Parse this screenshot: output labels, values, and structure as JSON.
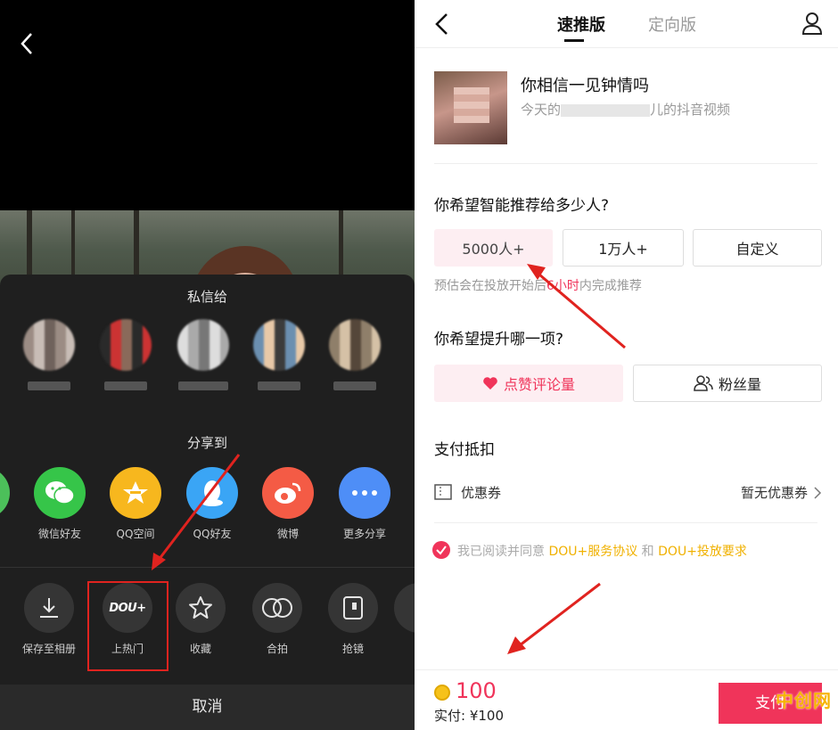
{
  "left": {
    "dm_title": "私信给",
    "share_title": "分享到",
    "share_items": [
      {
        "label": "微信好友",
        "icon": "wechat-icon",
        "color": "#36c549"
      },
      {
        "label": "QQ空间",
        "icon": "qzone-star-icon",
        "color": "#f7b71e"
      },
      {
        "label": "QQ好友",
        "icon": "qq-penguin-icon",
        "color": "#3aa5f5"
      },
      {
        "label": "微博",
        "icon": "weibo-icon",
        "color": "#f45b45"
      },
      {
        "label": "更多分享",
        "icon": "more-dots-icon",
        "color": "#4e8ef7"
      }
    ],
    "actions": [
      {
        "label": "保存至相册",
        "icon": "download-icon"
      },
      {
        "label": "上热门",
        "icon": "dou-plus-icon",
        "logo_text": "DOU+"
      },
      {
        "label": "收藏",
        "icon": "star-icon"
      },
      {
        "label": "合拍",
        "icon": "duet-icon"
      },
      {
        "label": "抢镜",
        "icon": "react-icon"
      }
    ],
    "cancel": "取消"
  },
  "right": {
    "tabs": {
      "active": "速推版",
      "inactive": "定向版"
    },
    "video": {
      "title": "你相信一见钟情吗",
      "sub_prefix": "今天的",
      "sub_suffix": "儿的抖音视频"
    },
    "q1": "你希望智能推荐给多少人?",
    "audience_options": [
      "5000人+",
      "1万人+",
      "自定义"
    ],
    "hint": {
      "prefix": "预估会在投放开始后",
      "em": "6小时",
      "suffix": "内完成推荐"
    },
    "q2": "你希望提升哪一项?",
    "goal_options": [
      {
        "label": "点赞评论量",
        "icon": "heart-icon"
      },
      {
        "label": "粉丝量",
        "icon": "users-icon"
      }
    ],
    "payment_title": "支付抵扣",
    "coupon_label": "优惠券",
    "coupon_value": "暂无优惠券",
    "agree": {
      "prefix": "我已阅读并同意 ",
      "link1": "DOU+服务协议",
      "mid": " 和 ",
      "link2": "DOU+投放要求"
    },
    "amount": "100",
    "paid": "实付: ¥100",
    "pay_button": "支付"
  },
  "watermark": "中创网",
  "colors": {
    "accent": "#f0345a",
    "gold": "#f0b100",
    "annotation": "#e0231f"
  }
}
